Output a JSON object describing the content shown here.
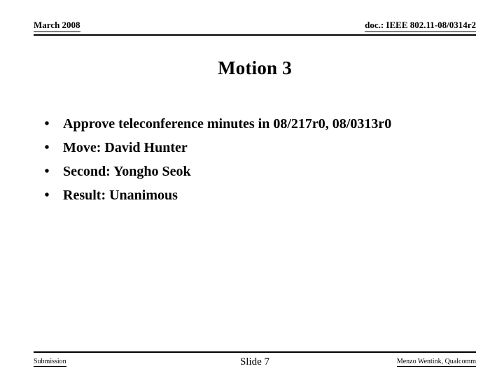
{
  "slide": {
    "background_color": "#ffffff",
    "text_color": "#000000"
  },
  "header": {
    "date": "March 2008",
    "doc_reference": "doc.: IEEE 802.11-08/0314r2"
  },
  "title": "Motion 3",
  "body": {
    "bullet_glyph": "•",
    "items": [
      {
        "text": "Approve teleconference minutes in 08/217r0, 08/0313r0"
      },
      {
        "text": "Move: David Hunter"
      },
      {
        "text": "Second: Yongho Seok"
      },
      {
        "text": "Result: Unanimous"
      }
    ]
  },
  "footer": {
    "left": "Submission",
    "center": "Slide 7",
    "right": "Menzo Wentink, Qualcomm"
  }
}
